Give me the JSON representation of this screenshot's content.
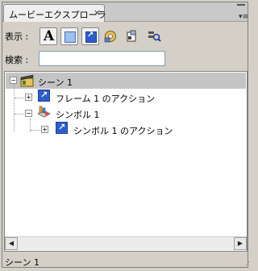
{
  "panel": {
    "tab_title": "ムービーエクスプローラ",
    "close_glyph": "×",
    "menu_glyph": "▾≡"
  },
  "toolbar": {
    "show_label": "表示 :",
    "buttons": [
      {
        "name": "text",
        "glyph": "A"
      },
      {
        "name": "buttons-movieclips-graphics"
      },
      {
        "name": "actionscript"
      },
      {
        "name": "video-sound-bitmap"
      },
      {
        "name": "frames-layers"
      },
      {
        "name": "customize"
      }
    ]
  },
  "search": {
    "label": "検索 :",
    "value": "",
    "placeholder": ""
  },
  "tree": {
    "scene": {
      "label": "シーン 1",
      "expander": "−"
    },
    "frame_actions": {
      "label": "フレーム 1 のアクション",
      "expander": "+"
    },
    "symbol": {
      "label": "シンボル 1",
      "expander": "−"
    },
    "symbol_actions": {
      "label": "シンボル 1 のアクション",
      "expander": "+"
    }
  },
  "scrollbar": {
    "left_arrow": "◀",
    "right_arrow": "▶"
  },
  "status": {
    "text": "シーン 1"
  },
  "colors": {
    "selected_row": "#c4c4c4",
    "action_icon": "#2e5ecb"
  }
}
